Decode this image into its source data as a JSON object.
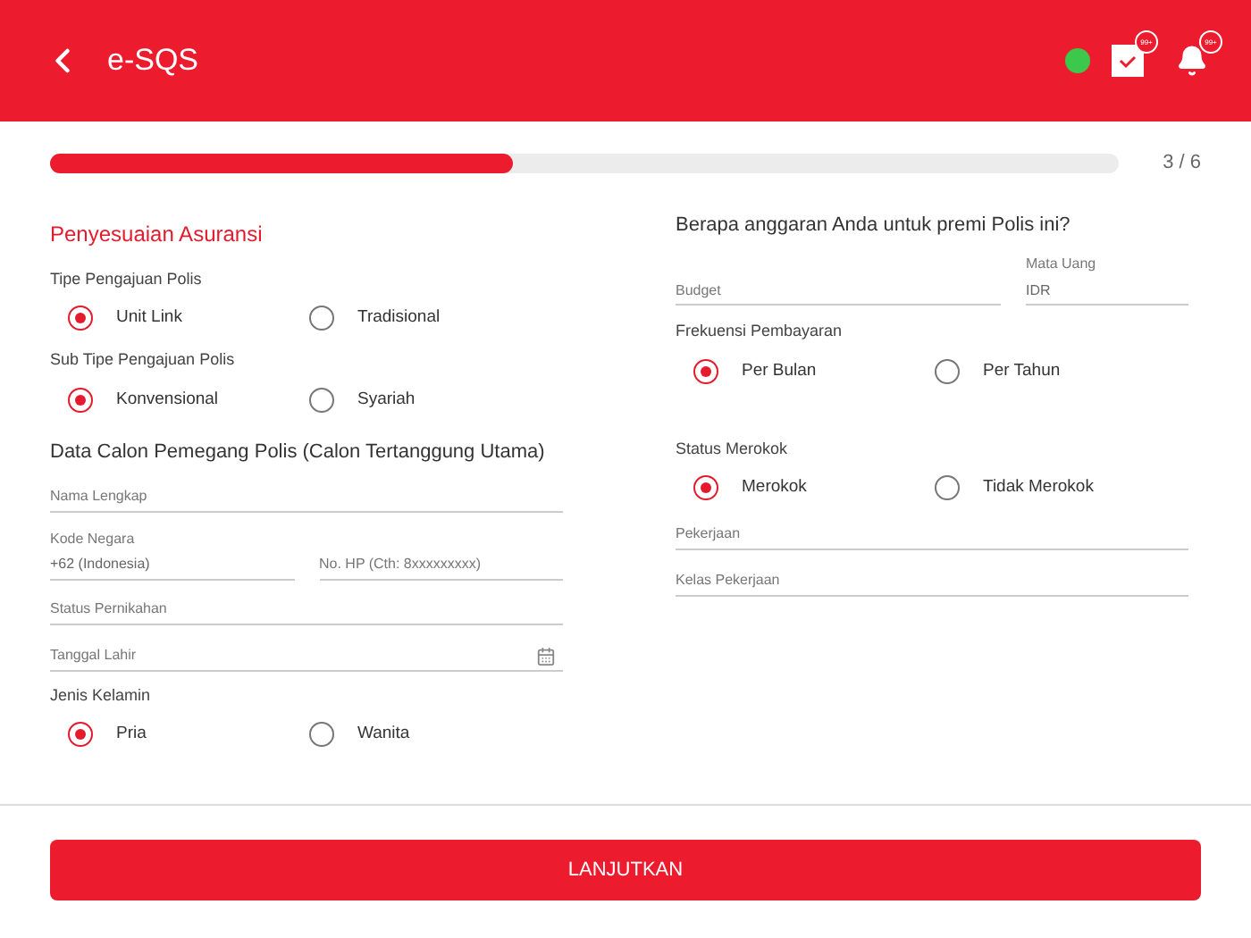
{
  "header": {
    "title": "e-SQS",
    "online": true,
    "badges": [
      "99+",
      "99+"
    ]
  },
  "progress": {
    "level": 0.433,
    "step": "3 / 6"
  },
  "left": [
    {
      "kind": "heading",
      "text": "Penyesuaian Asuransi"
    },
    {
      "kind": "label",
      "text": "Tipe Pengajuan Polis"
    },
    {
      "kind": "radio",
      "options": [
        {
          "label": "Unit Link",
          "selected": true
        },
        {
          "label": "Tradisional",
          "selected": false
        }
      ]
    },
    {
      "kind": "label",
      "text": "Sub Tipe Pengajuan Polis"
    },
    {
      "kind": "radio",
      "options": [
        {
          "label": "Konvensional",
          "selected": true
        },
        {
          "label": "Syariah",
          "selected": false
        }
      ]
    },
    {
      "kind": "section",
      "text": "Data Calon Pemegang Polis (Calon Tertanggung Utama)"
    },
    {
      "kind": "field",
      "placeholder": "Nama Lengkap"
    },
    {
      "kind": "pair",
      "fields": [
        {
          "label": "Kode Negara",
          "value": "+62 (Indonesia)"
        },
        {
          "placeholder": "No. HP (Cth: 8xxxxxxxxx)"
        }
      ]
    },
    {
      "kind": "field",
      "placeholder": "Status Pernikahan"
    },
    {
      "kind": "date",
      "placeholder": "Tanggal Lahir"
    },
    {
      "kind": "label",
      "text": "Jenis Kelamin"
    },
    {
      "kind": "radio",
      "options": [
        {
          "label": "Pria",
          "selected": true
        },
        {
          "label": "Wanita",
          "selected": false
        }
      ]
    }
  ],
  "right": [
    {
      "kind": "section",
      "text": "Berapa anggaran Anda untuk premi Polis ini?"
    },
    {
      "kind": "pair",
      "fields": [
        {
          "placeholder": "Budget"
        },
        {
          "label": "Mata Uang",
          "value": "IDR"
        }
      ]
    },
    {
      "kind": "label",
      "text": "Frekuensi Pembayaran"
    },
    {
      "kind": "radio",
      "options": [
        {
          "label": "Per Bulan",
          "selected": true
        },
        {
          "label": "Per Tahun",
          "selected": false
        }
      ]
    },
    {
      "kind": "spacer"
    },
    {
      "kind": "label",
      "text": "Status Merokok"
    },
    {
      "kind": "radio",
      "options": [
        {
          "label": "Merokok",
          "selected": true
        },
        {
          "label": "Tidak Merokok",
          "selected": false
        }
      ]
    },
    {
      "kind": "field",
      "placeholder": "Pekerjaan"
    },
    {
      "kind": "field",
      "placeholder": "Kelas Pekerjaan"
    }
  ],
  "button": "LANJUTKAN"
}
